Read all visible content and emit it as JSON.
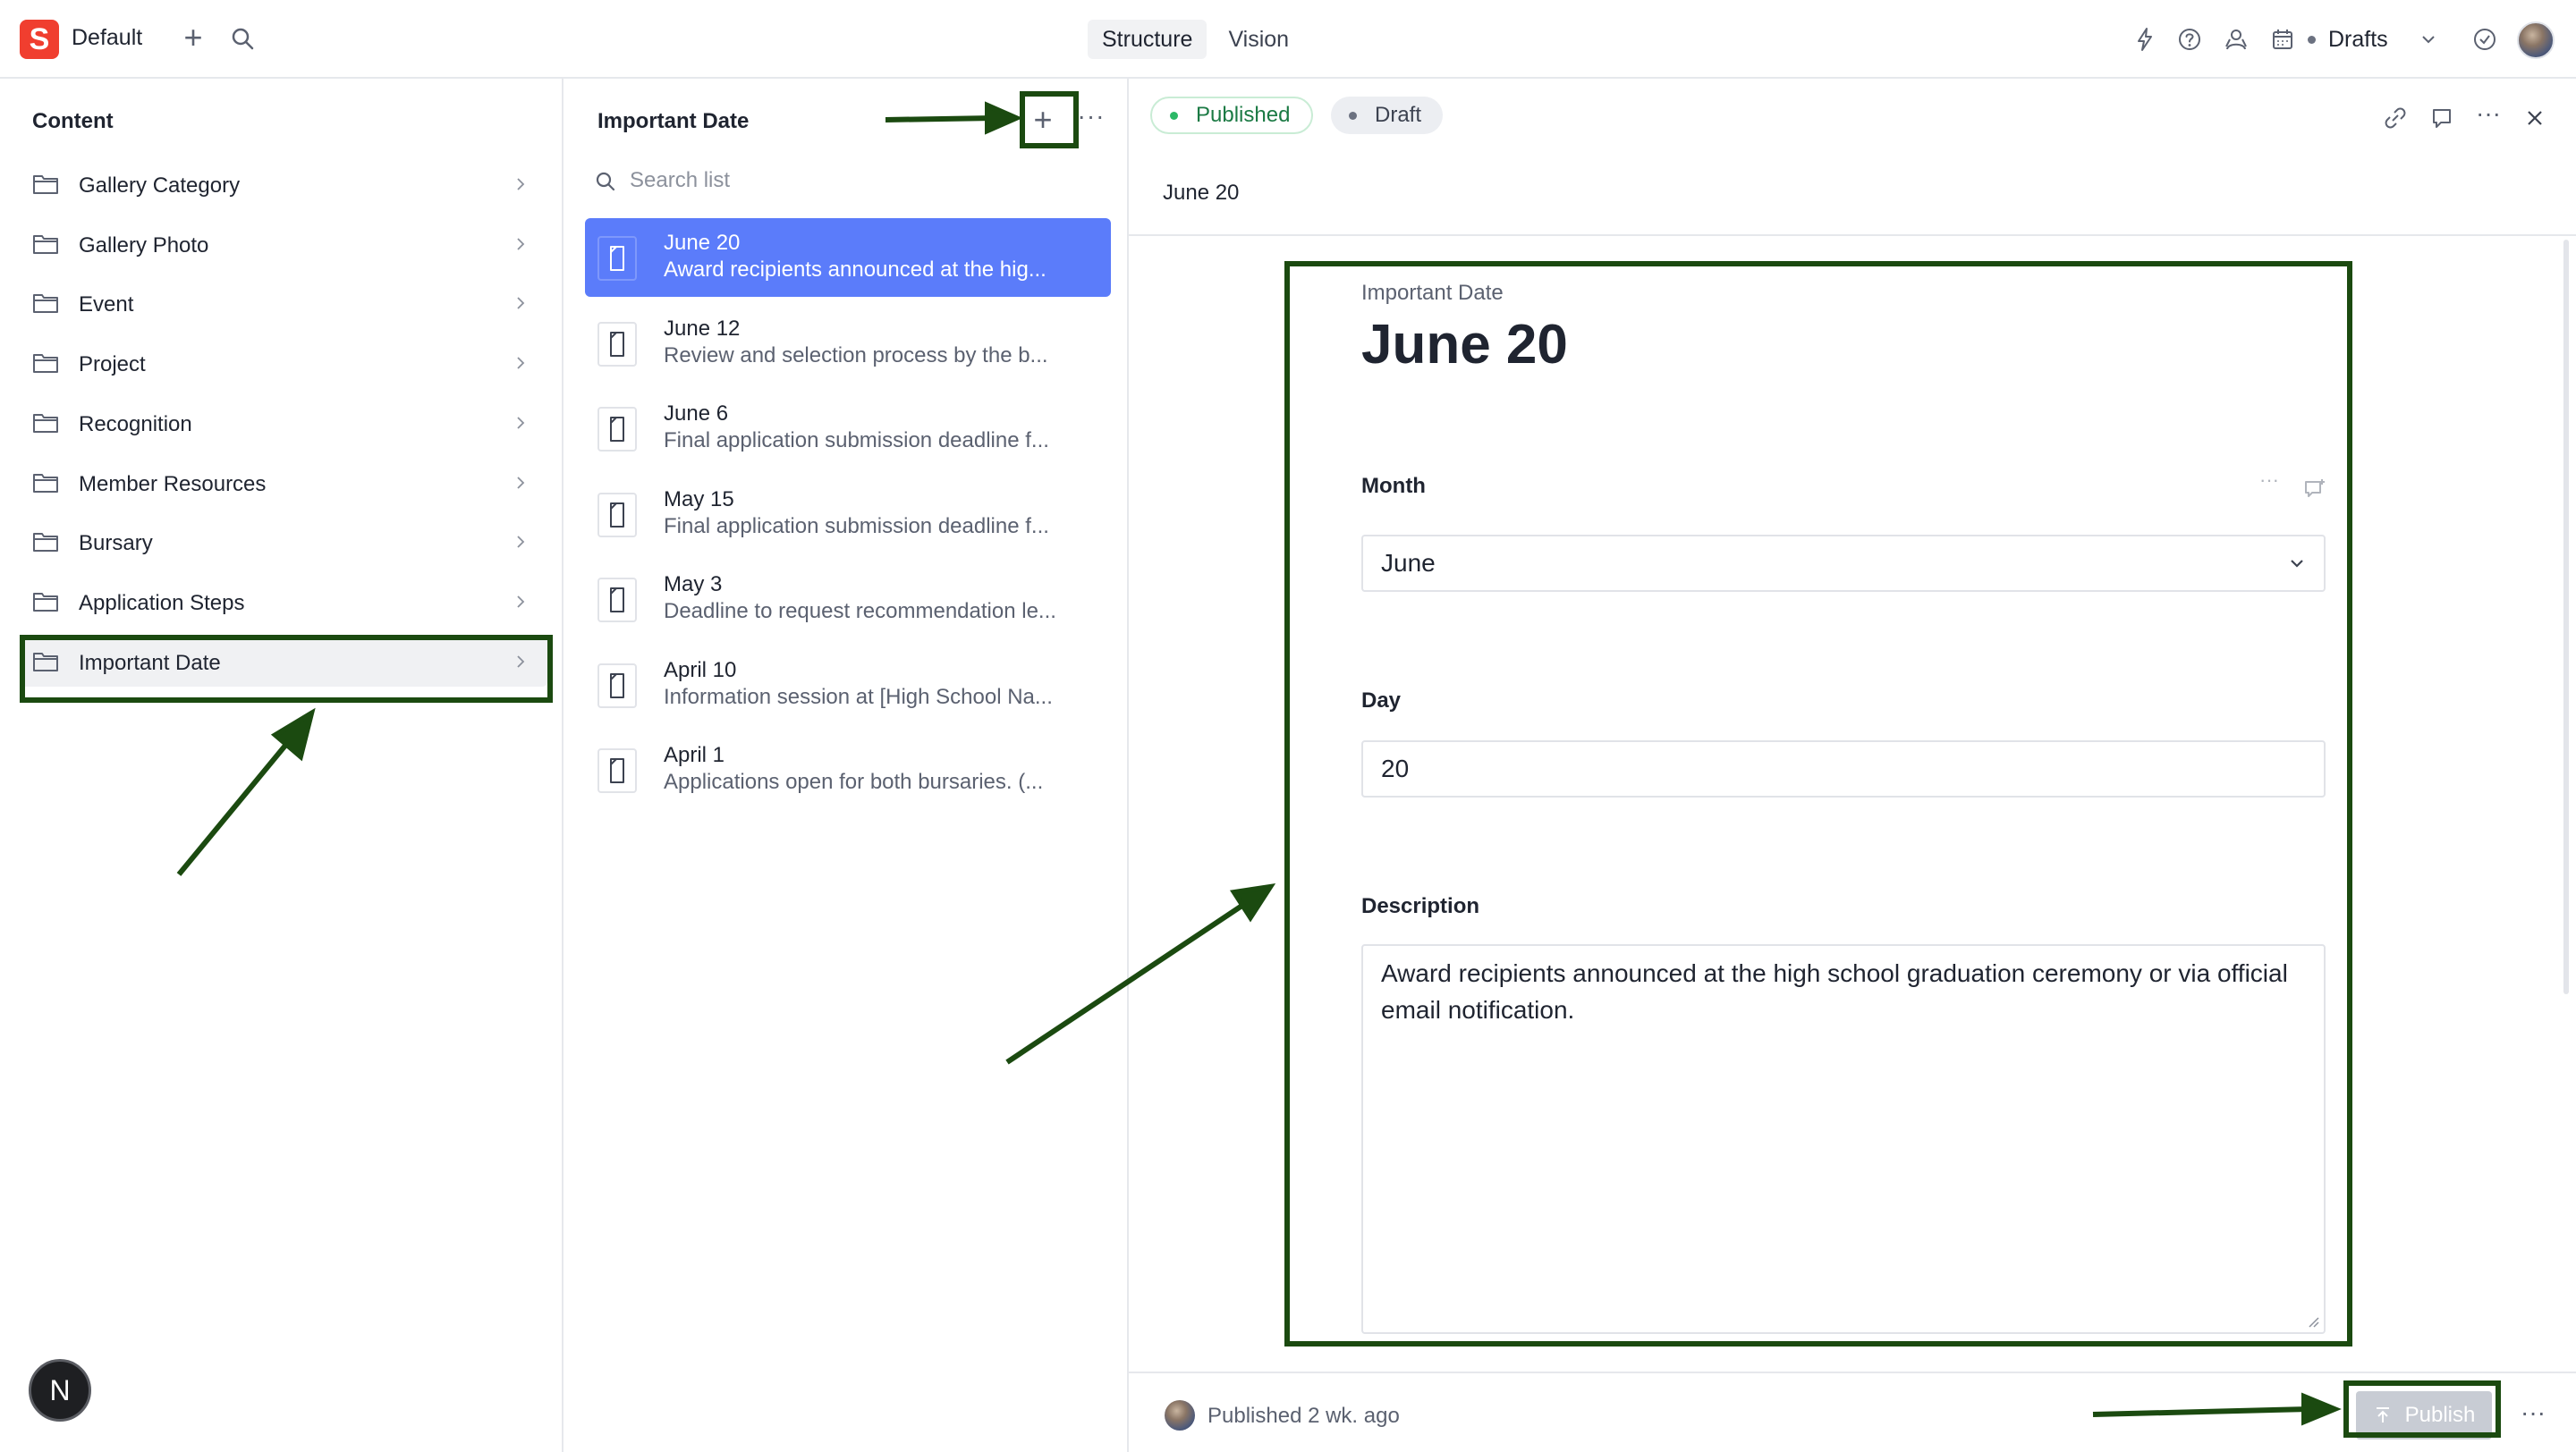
{
  "topbar": {
    "logo_letter": "S",
    "workspace": "Default",
    "tabs": [
      {
        "label": "Structure",
        "active": true
      },
      {
        "label": "Vision",
        "active": false
      }
    ],
    "drafts_label": "Drafts"
  },
  "content_pane": {
    "title": "Content",
    "items": [
      {
        "label": "Gallery Category"
      },
      {
        "label": "Gallery Photo"
      },
      {
        "label": "Event"
      },
      {
        "label": "Project"
      },
      {
        "label": "Recognition"
      },
      {
        "label": "Member Resources"
      },
      {
        "label": "Bursary"
      },
      {
        "label": "Application Steps"
      },
      {
        "label": "Important Date",
        "selected": true
      }
    ]
  },
  "list_pane": {
    "title": "Important Date",
    "search_placeholder": "Search list",
    "documents": [
      {
        "title": "June 20",
        "subtitle": "Award recipients announced at the hig...",
        "selected": true
      },
      {
        "title": "June 12",
        "subtitle": "Review and selection process by the b..."
      },
      {
        "title": "June 6",
        "subtitle": "Final application submission deadline f..."
      },
      {
        "title": "May 15",
        "subtitle": "Final application submission deadline f..."
      },
      {
        "title": "May 3",
        "subtitle": "Deadline to request recommendation le..."
      },
      {
        "title": "April 10",
        "subtitle": "Information session at [High School Na..."
      },
      {
        "title": "April 1",
        "subtitle": "Applications open for both bursaries. (..."
      }
    ]
  },
  "editor": {
    "status_published": "Published",
    "status_draft": "Draft",
    "document_heading": "June 20",
    "type_label": "Important Date",
    "title": "June 20",
    "fields": {
      "month": {
        "label": "Month",
        "value": "June"
      },
      "day": {
        "label": "Day",
        "value": "20"
      },
      "description": {
        "label": "Description",
        "value": "Award recipients announced at the high school graduation ceremony or via official email notification."
      }
    },
    "footer": {
      "status_text": "Published 2 wk. ago",
      "publish_label": "Publish"
    }
  },
  "floating_button": {
    "letter": "N"
  },
  "colors": {
    "brand": "#f03e2f",
    "selected_doc": "#5b7cfa",
    "published_dot": "#2bb866",
    "annotation": "#1b4a10"
  }
}
